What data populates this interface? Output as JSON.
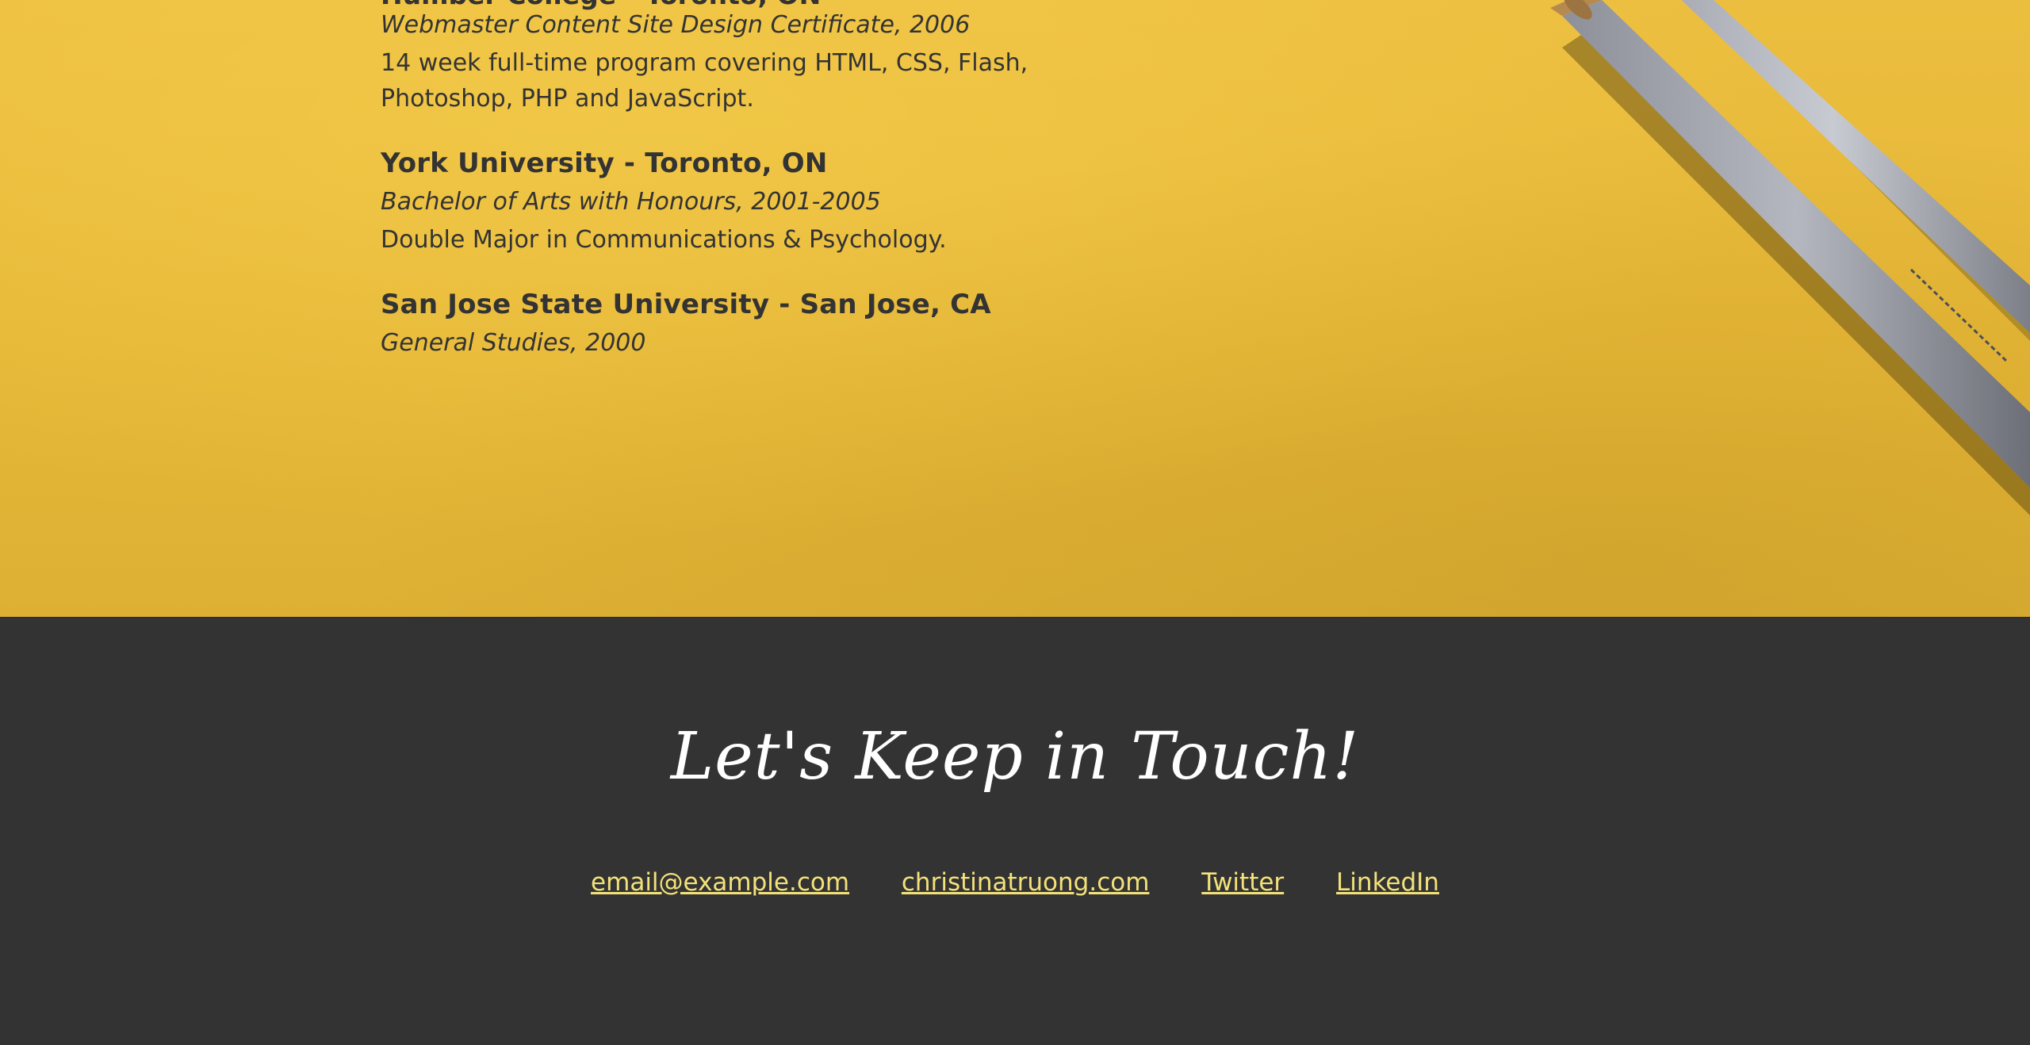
{
  "education": {
    "top_fragment_title": "Humber College - Toronto, ON",
    "items": [
      {
        "degree": "Webmaster Content Site Design Certificate, 2006",
        "desc_line1": "14 week full-time program covering HTML, CSS, Flash,",
        "desc_line2": "Photoshop, PHP and JavaScript."
      },
      {
        "name": "York University - Toronto, ON",
        "degree": "Bachelor of Arts with Honours, 2001-2005",
        "desc_line1": "Double Major in Communications & Psychology."
      },
      {
        "name": "San Jose State University - San Jose, CA",
        "degree": "General Studies, 2000"
      }
    ]
  },
  "footer": {
    "title": "Let's Keep in Touch!",
    "links": [
      {
        "label": "email@example.com"
      },
      {
        "label": "christinatruong.com"
      },
      {
        "label": "Twitter"
      },
      {
        "label": "LinkedIn"
      }
    ]
  },
  "colors": {
    "background_yellow": "#e6b737",
    "footer_bg": "#333333",
    "text_dark": "#333333",
    "link_yellow": "#f3e27a",
    "title_white": "#ffffff"
  }
}
